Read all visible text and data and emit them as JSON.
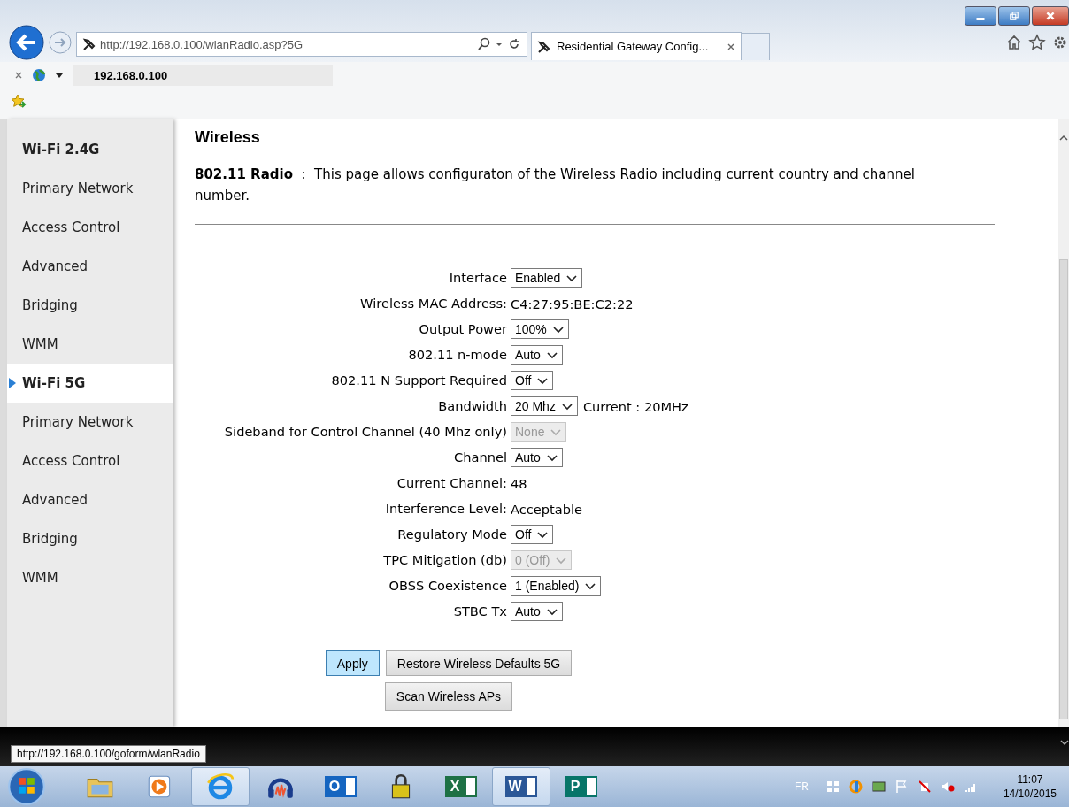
{
  "browser": {
    "address": "http://192.168.0.100/wlanRadio.asp?5G",
    "tab_title": "Residential Gateway Config...",
    "toolbar_address": "192.168.0.100"
  },
  "sidebar": {
    "sections": [
      {
        "title": "Wi-Fi 2.4G",
        "selected": false,
        "items": [
          "Primary Network",
          "Access Control",
          "Advanced",
          "Bridging",
          "WMM"
        ]
      },
      {
        "title": "Wi-Fi 5G",
        "selected": true,
        "items": [
          "Primary Network",
          "Access Control",
          "Advanced",
          "Bridging",
          "WMM"
        ]
      }
    ]
  },
  "page": {
    "title": "Wireless",
    "intro": "**802.11 Radio**  :  This page allows configuraton of the Wireless Radio including current country and channel number.",
    "fields": [
      {
        "kind": "select",
        "label": "Interface",
        "value": "Enabled",
        "disabled": false
      },
      {
        "kind": "text",
        "label": "Wireless MAC Address:",
        "value": "C4:27:95:BE:C2:22"
      },
      {
        "kind": "select",
        "label": "Output Power",
        "value": "100%",
        "disabled": false
      },
      {
        "kind": "select",
        "label": "802.11 n-mode",
        "value": "Auto",
        "disabled": false
      },
      {
        "kind": "select",
        "label": "802.11 N Support Required",
        "value": "Off",
        "disabled": false
      },
      {
        "kind": "select",
        "label": "Bandwidth",
        "value": "20 Mhz",
        "disabled": false,
        "note": "Current :  20MHz"
      },
      {
        "kind": "select",
        "label": "Sideband for Control Channel (40 Mhz only)",
        "value": "None",
        "disabled": true
      },
      {
        "kind": "select",
        "label": "Channel",
        "value": "Auto",
        "disabled": false
      },
      {
        "kind": "text",
        "label": "Current Channel:",
        "value": "48"
      },
      {
        "kind": "text",
        "label": "Interference Level:",
        "value": "Acceptable"
      },
      {
        "kind": "select",
        "label": "Regulatory Mode",
        "value": "Off",
        "disabled": false
      },
      {
        "kind": "select",
        "label": "TPC Mitigation (db)",
        "value": "0 (Off)",
        "disabled": true
      },
      {
        "kind": "select",
        "label": "OBSS Coexistence",
        "value": "1 (Enabled)",
        "disabled": false
      },
      {
        "kind": "select",
        "label": "STBC Tx",
        "value": "Auto",
        "disabled": false
      }
    ],
    "button_rows": [
      [
        {
          "label": "Apply",
          "focused": true
        },
        {
          "label": "Restore Wireless Defaults 5G",
          "focused": false
        }
      ],
      [
        {
          "label": "Scan Wireless APs",
          "focused": false
        }
      ]
    ]
  },
  "status_bar": {
    "url": "http://192.168.0.100/goform/wlanRadio"
  },
  "taskbar": {
    "apps": [
      {
        "kind": "folder",
        "active": false
      },
      {
        "kind": "media",
        "active": false
      },
      {
        "kind": "browser",
        "active": true
      },
      {
        "kind": "headphones",
        "active": false
      },
      {
        "kind": "office",
        "letter": "O",
        "color": "#1565c0",
        "active": false
      },
      {
        "kind": "lock",
        "active": false
      },
      {
        "kind": "office",
        "letter": "X",
        "color": "#1e7145",
        "active": false
      },
      {
        "kind": "office",
        "letter": "W",
        "color": "#2b5797",
        "active": true
      },
      {
        "kind": "office",
        "letter": "P",
        "color": "#077568",
        "active": false
      }
    ],
    "language": "FR",
    "time": "11:07",
    "date": "14/10/2015"
  }
}
